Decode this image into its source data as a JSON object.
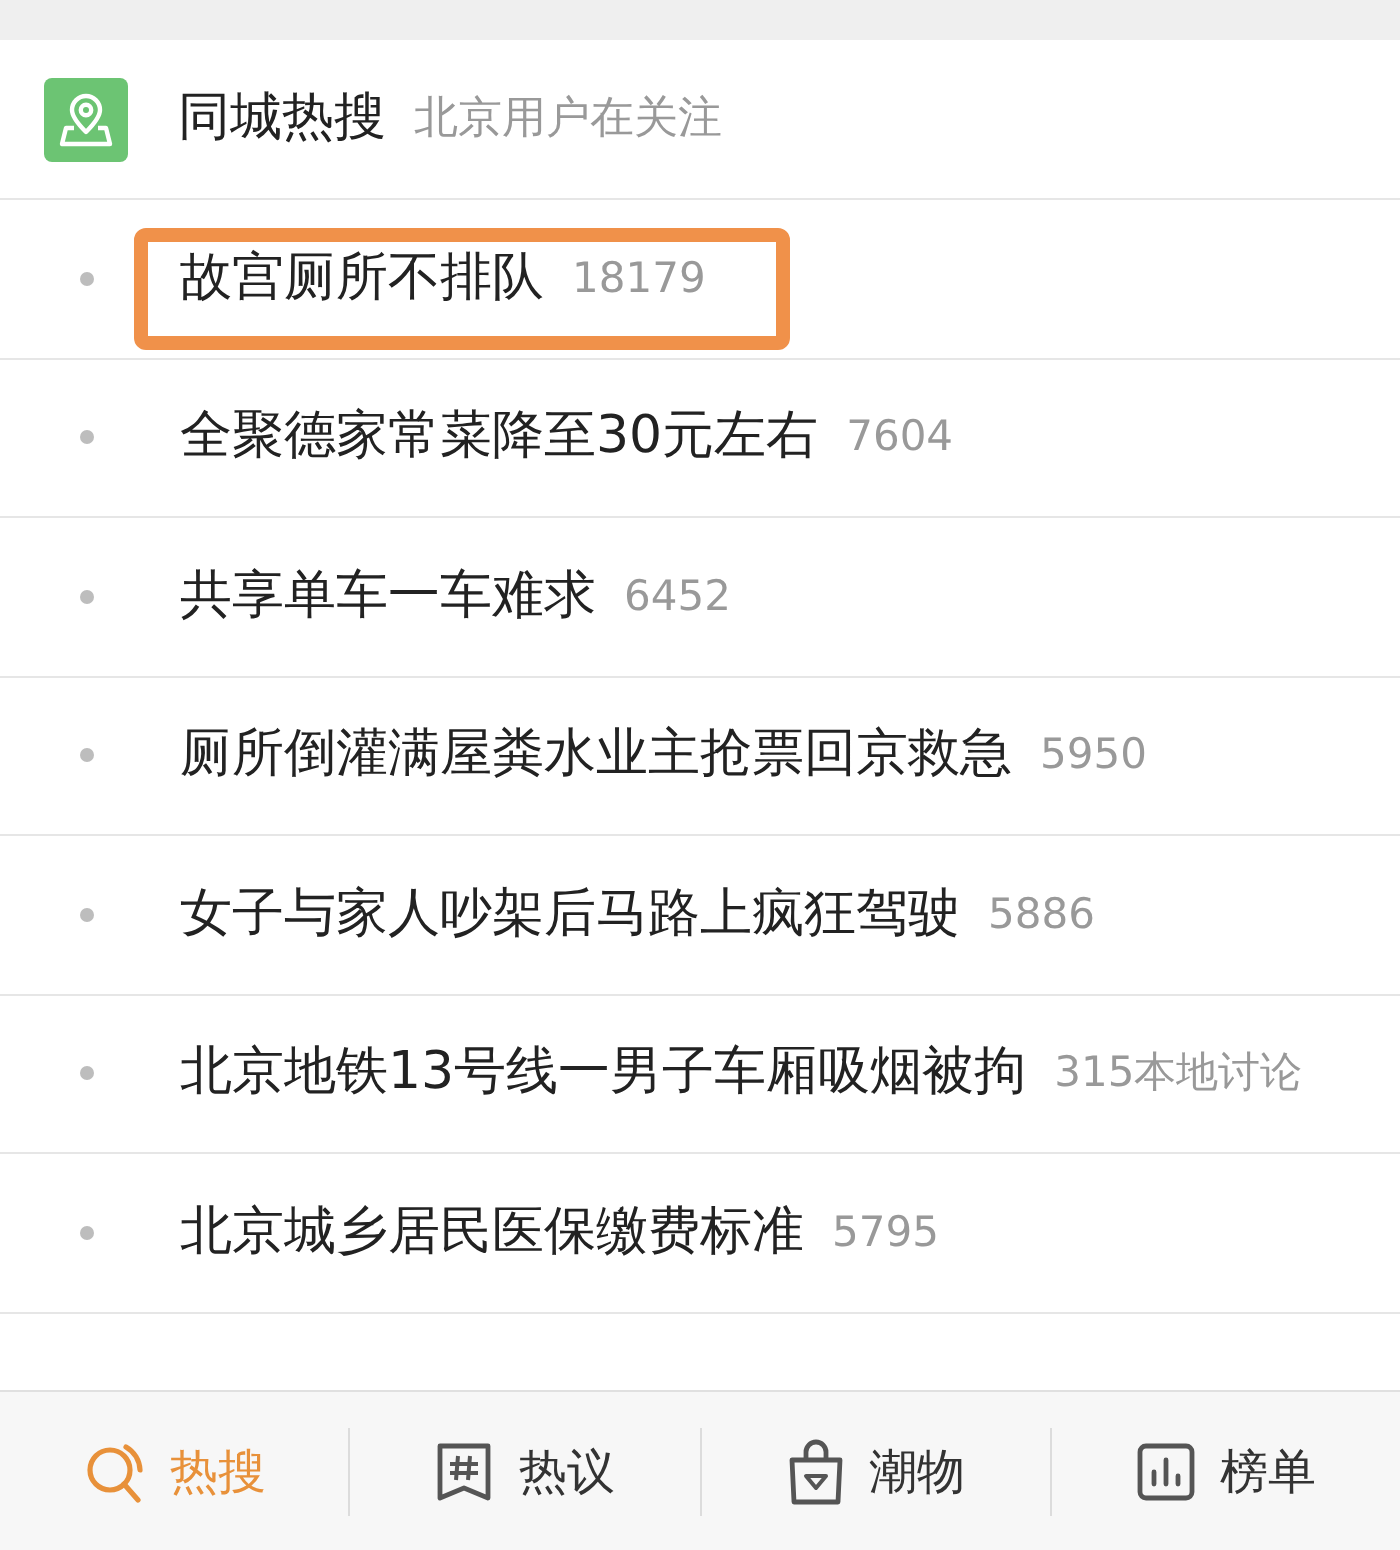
{
  "header": {
    "title": "同城热搜",
    "subtitle": "北京用户在关注"
  },
  "items": [
    {
      "title": "故宫厕所不排队",
      "count": "18179",
      "highlighted": true
    },
    {
      "title": "全聚德家常菜降至30元左右",
      "count": "7604",
      "highlighted": false
    },
    {
      "title": "共享单车一车难求",
      "count": "6452",
      "highlighted": false
    },
    {
      "title": "厕所倒灌满屋粪水业主抢票回京救急",
      "count": "5950",
      "highlighted": false
    },
    {
      "title": "女子与家人吵架后马路上疯狂驾驶",
      "count": "5886",
      "highlighted": false
    },
    {
      "title": "北京地铁13号线一男子车厢吸烟被拘",
      "count": "315本地讨论",
      "highlighted": false
    },
    {
      "title": "北京城乡居民医保缴费标准",
      "count": "5795",
      "highlighted": false
    }
  ],
  "tabs": [
    {
      "label": "热搜",
      "kind": "search",
      "selected": true
    },
    {
      "label": "热议",
      "kind": "topic",
      "selected": false
    },
    {
      "label": "潮物",
      "kind": "shop",
      "selected": false
    },
    {
      "label": "榜单",
      "kind": "chart",
      "selected": false
    }
  ]
}
